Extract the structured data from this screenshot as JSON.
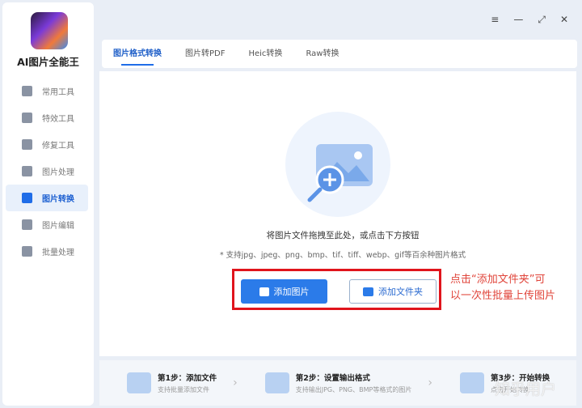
{
  "app": {
    "name": "AI图片全能王"
  },
  "window": {
    "menu_icon": "≡",
    "minimize_icon": "—",
    "restore_icon": "⤢",
    "close_icon": "✕"
  },
  "sidebar": {
    "items": [
      {
        "label": "常用工具",
        "icon": "grid-icon"
      },
      {
        "label": "特效工具",
        "icon": "star-icon"
      },
      {
        "label": "修复工具",
        "icon": "bandage-icon"
      },
      {
        "label": "图片处理",
        "icon": "image-icon"
      },
      {
        "label": "图片转换",
        "icon": "convert-icon",
        "active": true
      },
      {
        "label": "图片编辑",
        "icon": "edit-icon"
      },
      {
        "label": "批量处理",
        "icon": "folder-upload-icon"
      }
    ]
  },
  "tabs": [
    {
      "label": "图片格式转换",
      "active": true
    },
    {
      "label": "图片转PDF"
    },
    {
      "label": "Heic转换"
    },
    {
      "label": "Raw转换"
    }
  ],
  "main": {
    "hint": "将图片文件拖拽至此处，或点击下方按钮",
    "formats": "* 支持jpg、jpeg、png、bmp、tif、tiff、webp、gif等百余种图片格式",
    "add_image": "添加图片",
    "add_folder": "添加文件夹",
    "annotation_line1": "点击“添加文件夹”可",
    "annotation_line2": "以一次性批量上传图片"
  },
  "steps": [
    {
      "title": "第1步：添加文件",
      "sub": "支持批量添加文件"
    },
    {
      "title": "第2步：设置输出格式",
      "sub": "支持输出JPG、PNG、BMP等格式的图片"
    },
    {
      "title": "第3步：开始转换",
      "sub": "点击开始转换"
    }
  ],
  "watermark": "知乎用户"
}
